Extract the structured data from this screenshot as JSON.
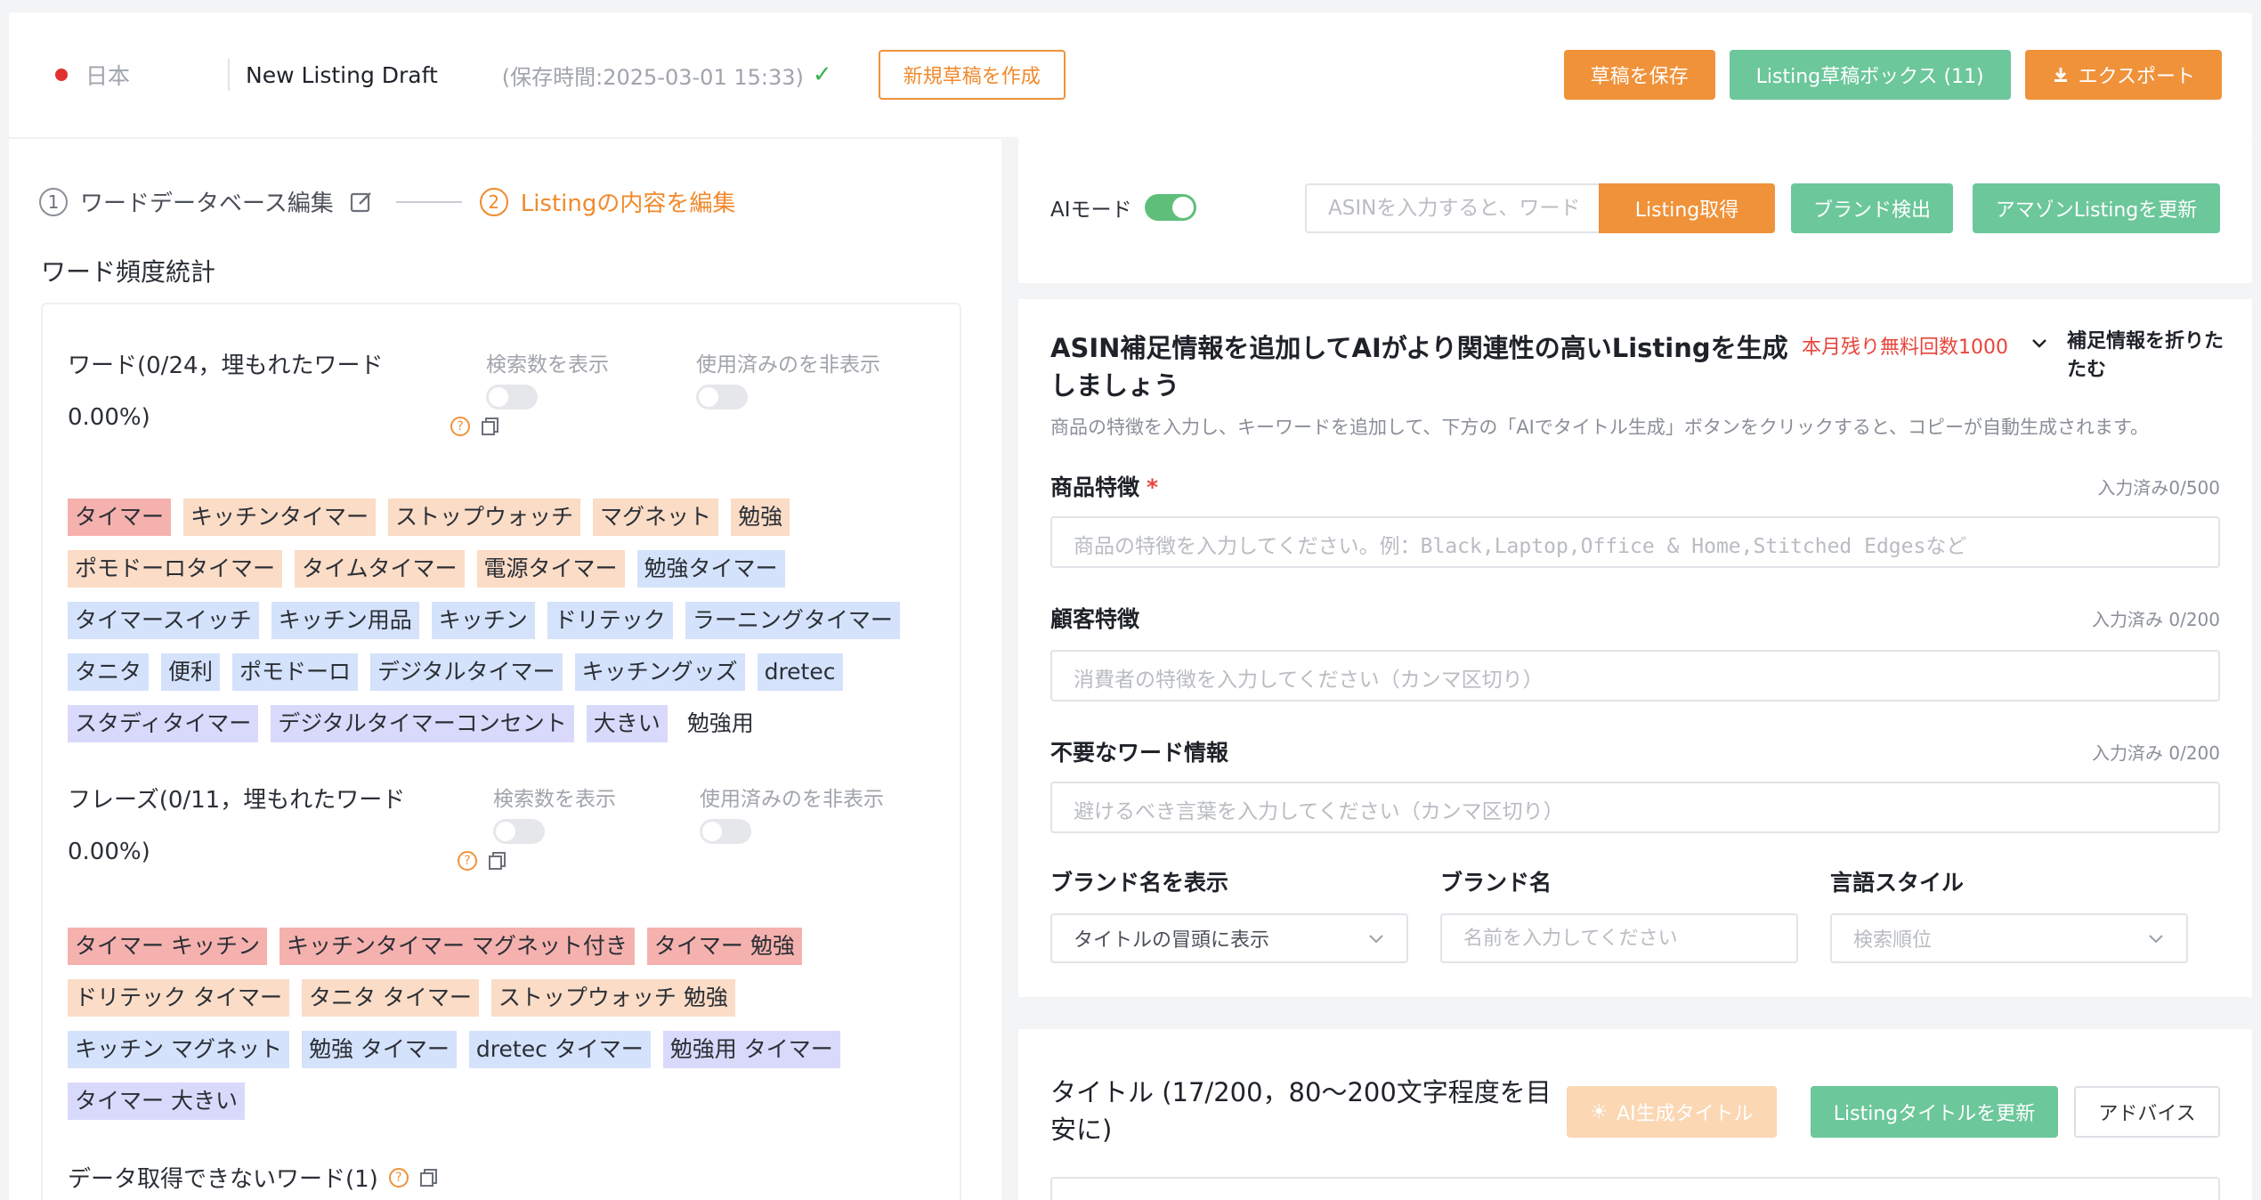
{
  "header": {
    "country": "日本",
    "draft_name": "New Listing Draft",
    "saved_time": "(保存時間:2025-03-01 15:33)",
    "new_draft_button": "新規草稿を作成",
    "save_button": "草稿を保存",
    "draft_box_button": "Listing草稿ボックス (11)",
    "export_button": "エクスポート"
  },
  "steps": [
    {
      "num": "1",
      "label": "ワードデータベース編集"
    },
    {
      "num": "2",
      "label": "Listingの内容を編集"
    }
  ],
  "left": {
    "section_title": "ワード頻度統計",
    "words": {
      "title": "ワード(0/24，埋もれたワード 0.00%)",
      "show_search_count": "検索数を表示",
      "hide_used": "使用済みのを非表示",
      "tags": [
        {
          "text": "タイマー",
          "color": "red"
        },
        {
          "text": "キッチンタイマー",
          "color": "orange"
        },
        {
          "text": "ストップウォッチ",
          "color": "orange"
        },
        {
          "text": "マグネット",
          "color": "orange"
        },
        {
          "text": "勉強",
          "color": "orange"
        },
        {
          "text": "ポモドーロタイマー",
          "color": "orange"
        },
        {
          "text": "タイムタイマー",
          "color": "orange"
        },
        {
          "text": "電源タイマー",
          "color": "orange"
        },
        {
          "text": "勉強タイマー",
          "color": "blue"
        },
        {
          "text": "タイマースイッチ",
          "color": "blue"
        },
        {
          "text": "キッチン用品",
          "color": "blue"
        },
        {
          "text": "キッチン",
          "color": "blue"
        },
        {
          "text": "ドリテック",
          "color": "blue"
        },
        {
          "text": "ラーニングタイマー",
          "color": "blue"
        },
        {
          "text": "タニタ",
          "color": "blue"
        },
        {
          "text": "便利",
          "color": "blue"
        },
        {
          "text": "ポモドーロ",
          "color": "blue"
        },
        {
          "text": "デジタルタイマー",
          "color": "blue"
        },
        {
          "text": "キッチングッズ",
          "color": "blue"
        },
        {
          "text": "dretec",
          "color": "blue"
        },
        {
          "text": "スタディタイマー",
          "color": "purple"
        },
        {
          "text": "デジタルタイマーコンセント",
          "color": "purple"
        },
        {
          "text": "大きい",
          "color": "purple"
        },
        {
          "text": "勉強用",
          "color": "none"
        }
      ]
    },
    "phrases": {
      "title": "フレーズ(0/11，埋もれたワード 0.00%)",
      "show_search_count": "検索数を表示",
      "hide_used": "使用済みのを非表示",
      "tags": [
        {
          "text": "タイマー キッチン",
          "color": "red"
        },
        {
          "text": "キッチンタイマー マグネット付き",
          "color": "red"
        },
        {
          "text": "タイマー 勉強",
          "color": "red"
        },
        {
          "text": "ドリテック タイマー",
          "color": "orange"
        },
        {
          "text": "タニタ タイマー",
          "color": "orange"
        },
        {
          "text": "ストップウォッチ 勉強",
          "color": "orange"
        },
        {
          "text": "キッチン マグネット",
          "color": "blue"
        },
        {
          "text": "勉強 タイマー",
          "color": "blue"
        },
        {
          "text": "dretec タイマー",
          "color": "blue"
        },
        {
          "text": "勉強用 タイマー",
          "color": "purple"
        },
        {
          "text": "タイマー 大きい",
          "color": "purple"
        }
      ]
    },
    "no_data_title": "データ取得できないワード(1)"
  },
  "ai_panel": {
    "ai_mode_label": "AIモード",
    "asin_placeholder": "ASINを入力すると、ワード",
    "get_listing_button": "Listing取得",
    "brand_detect_button": "ブランド検出",
    "update_amazon_button": "アマゾンListingを更新"
  },
  "info_panel": {
    "title": "ASIN補足情報を追加してAIがより関連性の高いListingを生成しましょう",
    "remaining": "本月残り無料回数1000",
    "collapse": "補足情報を折りたたむ",
    "description": "商品の特徴を入力し、キーワードを追加して、下方の「AIでタイトル生成」ボタンをクリックすると、コピーが自動生成されます。",
    "product_features_label": "商品特徴",
    "product_features_required": "*",
    "product_features_count": "入力済み0/500",
    "product_features_placeholder": "商品の特徴を入力してください。例：Black,Laptop,Office & Home,Stitched Edgesなど",
    "customer_label": "顧客特徴",
    "customer_count": "入力済み 0/200",
    "customer_placeholder": "消費者の特徴を入力してください（カンマ区切り）",
    "unwanted_label": "不要なワード情報",
    "unwanted_count": "入力済み 0/200",
    "unwanted_placeholder": "避けるべき言葉を入力してください（カンマ区切り）",
    "brand_display_label": "ブランド名を表示",
    "brand_display_value": "タイトルの冒頭に表示",
    "brand_name_label": "ブランド名",
    "brand_name_placeholder": "名前を入力してください",
    "lang_style_label": "言語スタイル",
    "lang_style_placeholder": "検索順位"
  },
  "title_panel": {
    "title": "タイトル (17/200，80〜200文字程度を目安に)",
    "ai_title_button": "AI生成タイトル",
    "update_title_button": "Listingタイトルを更新",
    "advice_button": "アドバイス"
  },
  "colors": {
    "orange": "#f0923a",
    "green": "#6cc79a",
    "red_tag": "#f5b1ae",
    "orange_tag": "#fbdcc6",
    "blue_tag": "#d4e2fb",
    "purple_tag": "#d9dafb"
  }
}
